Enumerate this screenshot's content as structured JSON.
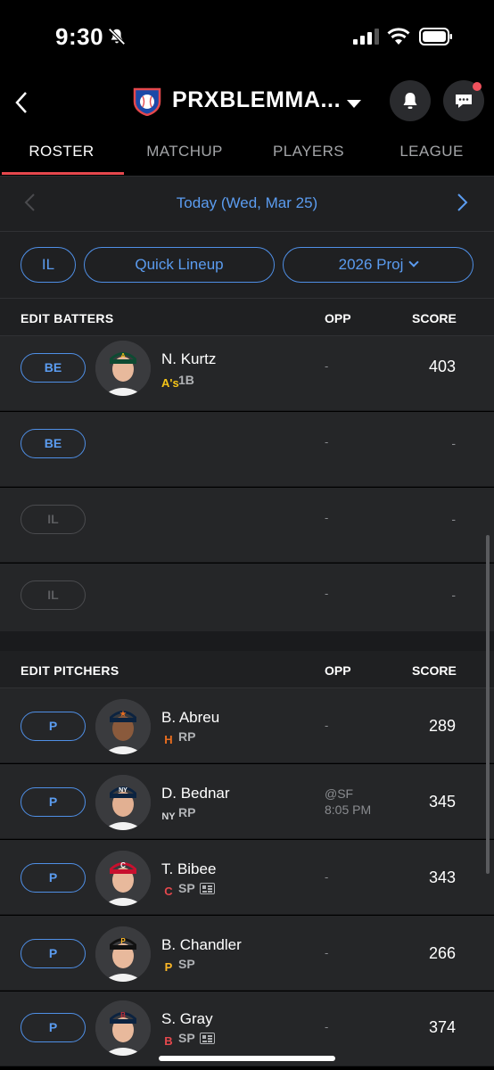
{
  "status_bar": {
    "time": "9:30"
  },
  "header": {
    "league_name": "PRXBLEMMA..."
  },
  "tabs": [
    {
      "label": "ROSTER",
      "active": true
    },
    {
      "label": "MATCHUP",
      "active": false
    },
    {
      "label": "PLAYERS",
      "active": false
    },
    {
      "label": "LEAGUE",
      "active": false
    }
  ],
  "date_bar": {
    "label": "Today (Wed, Mar 25)"
  },
  "filters": {
    "il": "IL",
    "quick_lineup": "Quick Lineup",
    "projection": "2026 Proj"
  },
  "batters": {
    "title": "EDIT BATTERS",
    "opp_header": "OPP",
    "score_header": "SCORE",
    "rows": [
      {
        "slot": "BE",
        "name": "N. Kurtz",
        "team": "A's",
        "position": "1B",
        "opp": "-",
        "score": "403"
      },
      {
        "slot": "BE",
        "opp": "-",
        "score": "-"
      },
      {
        "slot": "IL",
        "opp": "-",
        "score": "-"
      },
      {
        "slot": "IL",
        "opp": "-",
        "score": "-"
      }
    ]
  },
  "pitchers": {
    "title": "EDIT PITCHERS",
    "opp_header": "OPP",
    "score_header": "SCORE",
    "rows": [
      {
        "slot": "P",
        "name": "B. Abreu",
        "team": "H",
        "position": "RP",
        "opp": "-",
        "score": "289"
      },
      {
        "slot": "P",
        "name": "D. Bednar",
        "team": "NY",
        "position": "RP",
        "opp_line1": "@SF",
        "opp_line2": "8:05 PM",
        "score": "345"
      },
      {
        "slot": "P",
        "name": "T. Bibee",
        "team": "C",
        "position": "SP",
        "opp": "-",
        "score": "343"
      },
      {
        "slot": "P",
        "name": "B. Chandler",
        "team": "P",
        "position": "SP",
        "opp": "-",
        "score": "266"
      },
      {
        "slot": "P",
        "name": "S. Gray",
        "team": "B",
        "position": "SP",
        "opp": "-",
        "score": "374"
      }
    ]
  },
  "colors": {
    "accent": "#5b9cf0",
    "tab_underline": "#e5484d",
    "notification_dot": "#f0525d"
  }
}
